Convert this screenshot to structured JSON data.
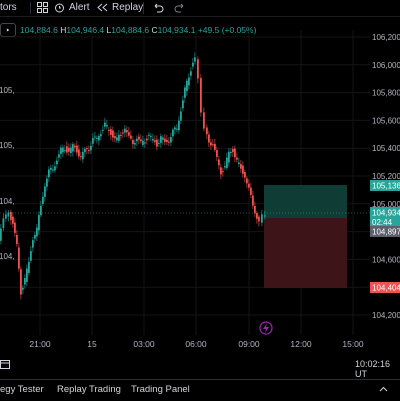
{
  "toolbar": {
    "indicators_label": "tors",
    "alert_label": "Alert",
    "replay_label": "Replay"
  },
  "ohlc": {
    "open": "104,884.6",
    "high_label": "H",
    "high": "104,946.4",
    "low_label": "L",
    "low": "104,884.6",
    "close_label": "C",
    "close": "104,934.1",
    "change": "+49.5 (+0.05%)"
  },
  "price_axis": {
    "ticks": [
      "106,200",
      "106,000",
      "105,800",
      "105,600",
      "105,400",
      "105,200",
      "105,000",
      "104,800",
      "104,600",
      "104,400",
      "104,200"
    ],
    "left_ticks": [
      "105,",
      "105,",
      "104,",
      "104,"
    ],
    "tp_label": "105,136",
    "current_price": "104,934",
    "countdown": "02:44",
    "entry_label": "104,897",
    "sl_label": "104,404"
  },
  "time_axis": {
    "ticks": [
      "21:00",
      "15",
      "03:00",
      "06:00",
      "09:00",
      "12:00",
      "15:00"
    ]
  },
  "status": {
    "clock": "10:02:16 UT"
  },
  "panels": {
    "tabs": [
      "egy Tester",
      "Replay Trading",
      "Trading Panel"
    ]
  },
  "colors": {
    "up": "#26a69a",
    "down": "#ef5350",
    "profit_zone": "#0f3d35",
    "loss_zone": "#3d1417",
    "background": "#000000"
  }
}
